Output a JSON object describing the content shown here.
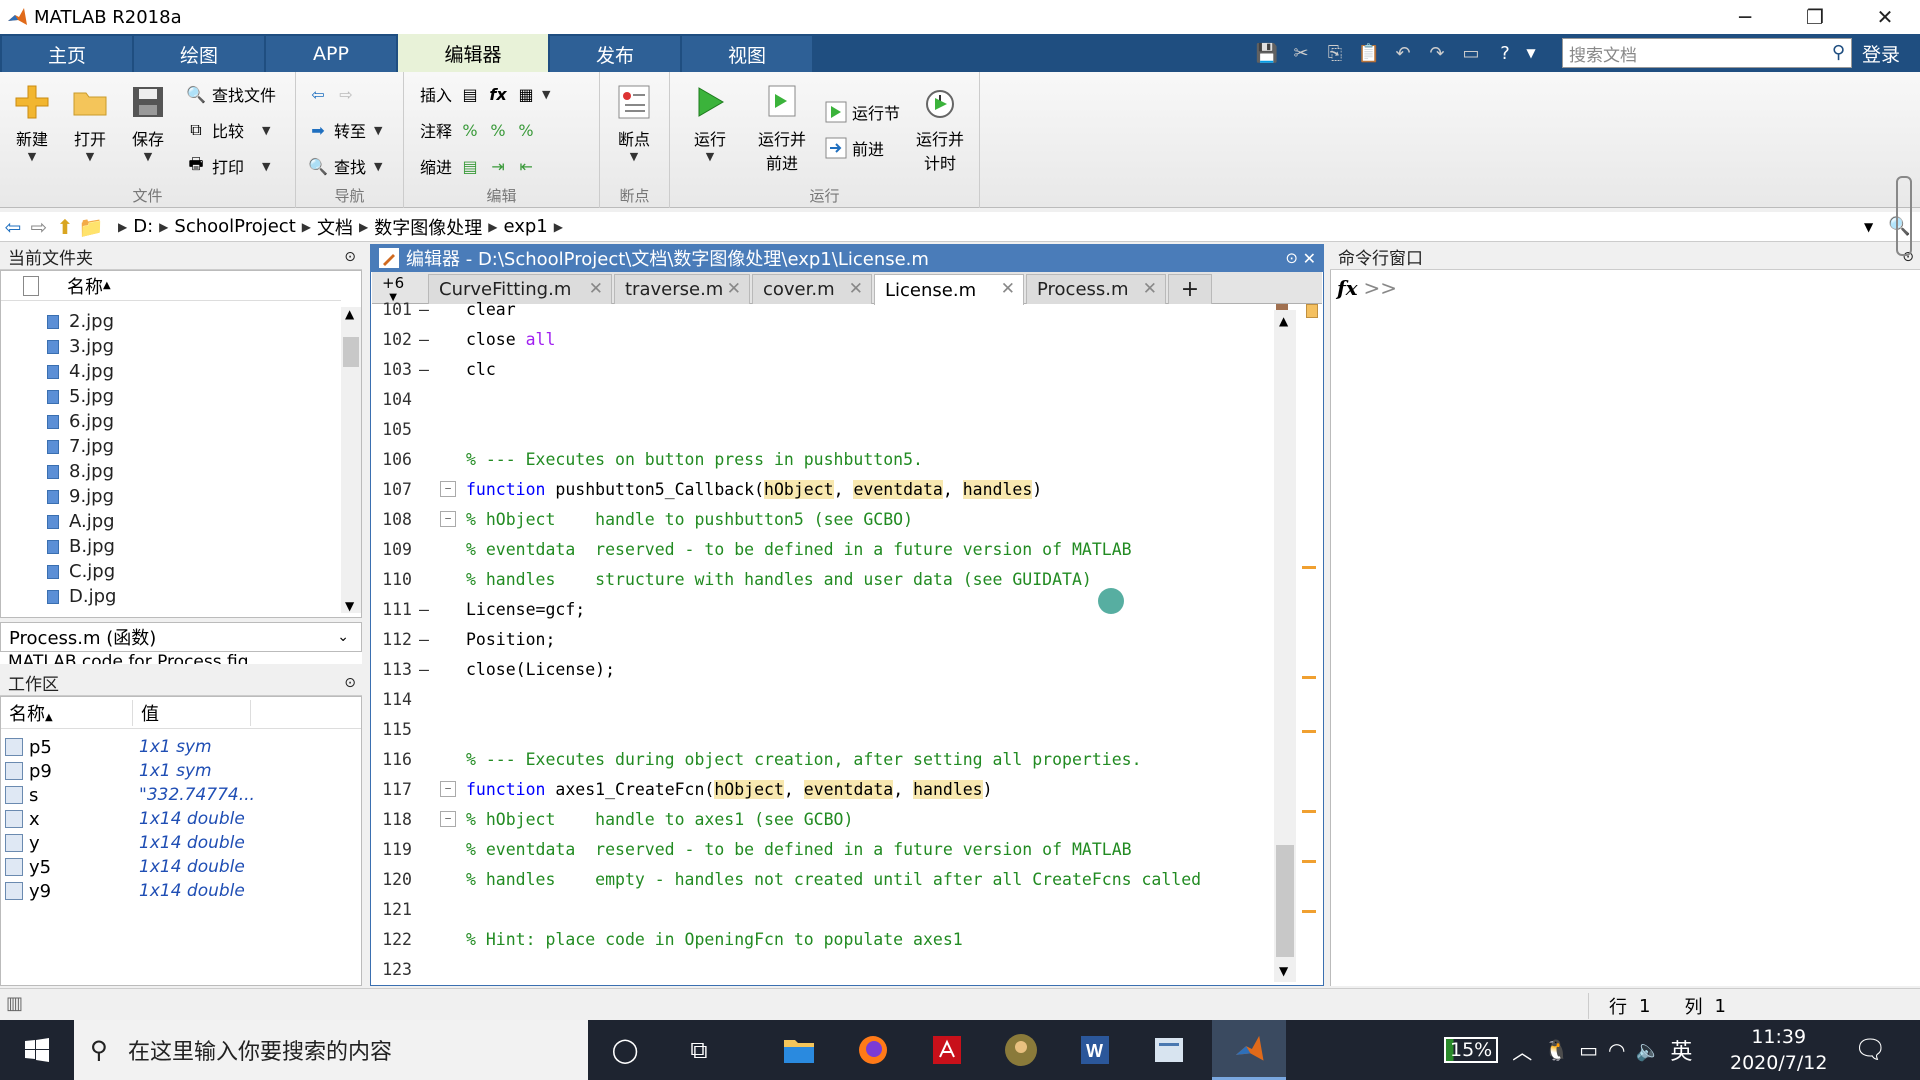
{
  "window": {
    "title": "MATLAB R2018a",
    "minimize": "─",
    "restore": "❐",
    "close": "✕"
  },
  "ribbon_tabs": [
    "主页",
    "绘图",
    "APP",
    "编辑器",
    "发布",
    "视图"
  ],
  "search": {
    "placeholder": "搜索文档"
  },
  "login_label": "登录",
  "ribbon": {
    "file": {
      "label": "文件",
      "new": "新建",
      "open": "打开",
      "save": "保存",
      "find_files": "查找文件",
      "compare": "比较",
      "print": "打印"
    },
    "navigate": {
      "label": "导航",
      "goto": "转至",
      "find": "查找"
    },
    "edit": {
      "label": "编辑",
      "insert": "插入",
      "comment": "注释",
      "indent": "缩进",
      "fx": "fx"
    },
    "breakpoints": {
      "label": "断点",
      "bp": "断点"
    },
    "run": {
      "label": "运行",
      "run": "运行",
      "run_advance": "运行并\n前进",
      "run_section": "运行节",
      "advance": "前进",
      "run_time": "运行并\n计时"
    }
  },
  "address": {
    "crumbs": [
      "D:",
      "SchoolProject",
      "文档",
      "数字图像处理",
      "exp1"
    ]
  },
  "current_folder": {
    "title": "当前文件夹",
    "col_name": "名称",
    "files": [
      "2.jpg",
      "3.jpg",
      "4.jpg",
      "5.jpg",
      "6.jpg",
      "7.jpg",
      "8.jpg",
      "9.jpg",
      "A.jpg",
      "B.jpg",
      "C.jpg",
      "D.jpg"
    ],
    "details_title": "Process.m  (函数)",
    "details_desc": "MATLAB code for Process.fig"
  },
  "workspace": {
    "title": "工作区",
    "col_name": "名称",
    "col_value": "值",
    "vars": [
      {
        "name": "p5",
        "value": "1x1 sym"
      },
      {
        "name": "p9",
        "value": "1x1 sym"
      },
      {
        "name": "s",
        "value": "\"332.74774..."
      },
      {
        "name": "x",
        "value": "1x14 double"
      },
      {
        "name": "y",
        "value": "1x14 double"
      },
      {
        "name": "y5",
        "value": "1x14 double"
      },
      {
        "name": "y9",
        "value": "1x14 double"
      }
    ]
  },
  "editor": {
    "title": "编辑器 - D:\\SchoolProject\\文档\\数字图像处理\\exp1\\License.m",
    "more_tabs": "+6",
    "tabs": [
      "CurveFitting.m",
      "traverse.m",
      "cover.m",
      "License.m",
      "Process.m"
    ],
    "active_tab": "License.m",
    "add_tab": "+",
    "lines": [
      {
        "n": "101",
        "dash": "—",
        "t": "clear"
      },
      {
        "n": "102",
        "dash": "—",
        "t": "close all"
      },
      {
        "n": "103",
        "dash": "—",
        "t": "clc"
      },
      {
        "n": "104",
        "dash": "",
        "t": ""
      },
      {
        "n": "105",
        "dash": "",
        "t": ""
      },
      {
        "n": "106",
        "dash": "",
        "t": "% --- Executes on button press in pushbutton5."
      },
      {
        "n": "107",
        "dash": "",
        "t": "function pushbutton5_Callback(hObject, eventdata, handles)"
      },
      {
        "n": "108",
        "dash": "",
        "t": "% hObject    handle to pushbutton5 (see GCBO)"
      },
      {
        "n": "109",
        "dash": "",
        "t": "% eventdata  reserved - to be defined in a future version of MATLAB"
      },
      {
        "n": "110",
        "dash": "",
        "t": "% handles    structure with handles and user data (see GUIDATA)"
      },
      {
        "n": "111",
        "dash": "—",
        "t": "License=gcf;"
      },
      {
        "n": "112",
        "dash": "—",
        "t": "Position;"
      },
      {
        "n": "113",
        "dash": "—",
        "t": "close(License);"
      },
      {
        "n": "114",
        "dash": "",
        "t": ""
      },
      {
        "n": "115",
        "dash": "",
        "t": ""
      },
      {
        "n": "116",
        "dash": "",
        "t": "% --- Executes during object creation, after setting all properties."
      },
      {
        "n": "117",
        "dash": "",
        "t": "function axes1_CreateFcn(hObject, eventdata, handles)"
      },
      {
        "n": "118",
        "dash": "",
        "t": "% hObject    handle to axes1 (see GCBO)"
      },
      {
        "n": "119",
        "dash": "",
        "t": "% eventdata  reserved - to be defined in a future version of MATLAB"
      },
      {
        "n": "120",
        "dash": "",
        "t": "% handles    empty - handles not created until after all CreateFcns called"
      },
      {
        "n": "121",
        "dash": "",
        "t": ""
      },
      {
        "n": "122",
        "dash": "",
        "t": "% Hint: place code in OpeningFcn to populate axes1"
      },
      {
        "n": "123",
        "dash": "",
        "t": ""
      }
    ]
  },
  "command_window": {
    "title": "命令行窗口",
    "prompt": ">>",
    "fx": "fx"
  },
  "status": {
    "row_label": "行",
    "row": "1",
    "col_label": "列",
    "col": "1"
  },
  "taskbar": {
    "search_placeholder": "在这里输入你要搜索的内容",
    "battery": "15%",
    "ime": "英",
    "time": "11:39",
    "date": "2020/7/12"
  },
  "colors": {
    "tab_bar": "#1f4e80",
    "active_tab": "#e8f2d8",
    "editor_title": "#4a7cb9",
    "keyword": "#0000ff",
    "comment": "#228b22",
    "string": "#a020f0"
  }
}
